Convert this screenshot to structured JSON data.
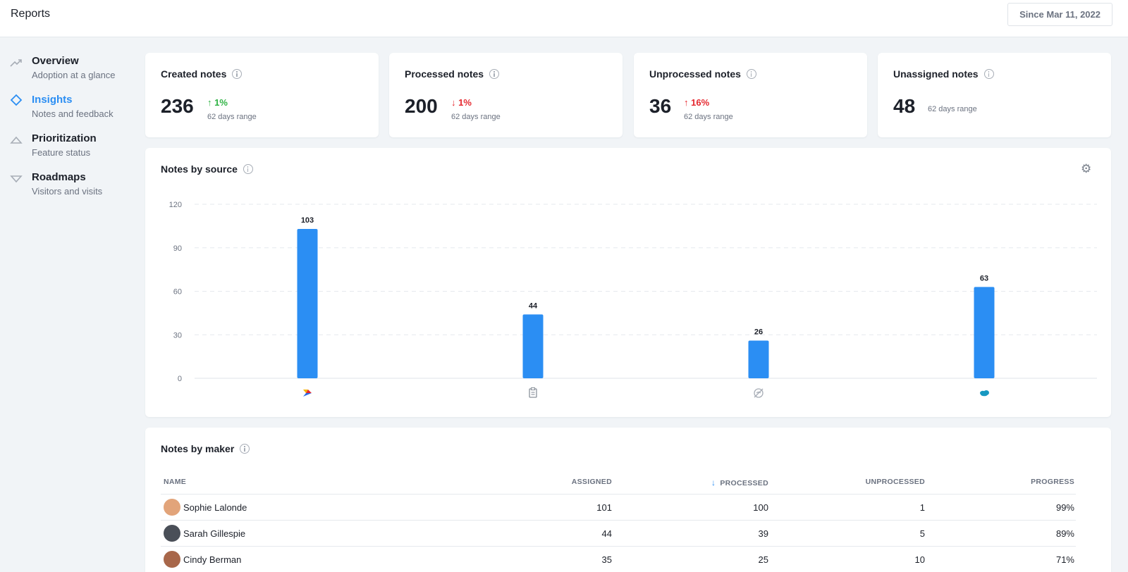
{
  "header": {
    "title": "Reports",
    "date_range": "Since Mar 11, 2022"
  },
  "sidebar": {
    "items": [
      {
        "label": "Overview",
        "sub": "Adoption at a glance",
        "icon": "trend-up-icon"
      },
      {
        "label": "Insights",
        "sub": "Notes and feedback",
        "icon": "diamond-icon",
        "active": true
      },
      {
        "label": "Prioritization",
        "sub": "Feature status",
        "icon": "triangle-up-icon"
      },
      {
        "label": "Roadmaps",
        "sub": "Visitors and visits",
        "icon": "triangle-down-icon"
      }
    ]
  },
  "stats": [
    {
      "title": "Created notes",
      "value": "236",
      "change": "1%",
      "direction": "up",
      "range": "62 days range"
    },
    {
      "title": "Processed notes",
      "value": "200",
      "change": "1%",
      "direction": "down",
      "range": "62 days range"
    },
    {
      "title": "Unprocessed notes",
      "value": "36",
      "change": "16%",
      "direction": "up-bad",
      "range": "62 days range"
    },
    {
      "title": "Unassigned notes",
      "value": "48",
      "change": "",
      "direction": "none",
      "range": "62 days range"
    }
  ],
  "notes_by_source": {
    "title": "Notes by source",
    "chart_data": {
      "type": "bar",
      "categories": [
        "productboard",
        "manual-note",
        "hidden-source",
        "salesforce"
      ],
      "values": [
        103,
        44,
        26,
        63
      ],
      "yticks": [
        0,
        30,
        60,
        90,
        120
      ],
      "ylim": [
        0,
        120
      ],
      "grid": true,
      "bar_color": "#2b8ef3"
    }
  },
  "notes_by_maker": {
    "title": "Notes by maker",
    "columns": [
      "NAME",
      "ASSIGNED",
      "PROCESSED",
      "UNPROCESSED",
      "PROGRESS"
    ],
    "sorted_column": "PROCESSED",
    "rows": [
      {
        "name": "Sophie Lalonde",
        "assigned": "101",
        "processed": "100",
        "unprocessed": "1",
        "progress": "99%",
        "avatar_color": "#e2a47a"
      },
      {
        "name": "Sarah Gillespie",
        "assigned": "44",
        "processed": "39",
        "unprocessed": "5",
        "progress": "89%",
        "avatar_color": "#4a4f58"
      },
      {
        "name": "Cindy Berman",
        "assigned": "35",
        "processed": "25",
        "unprocessed": "10",
        "progress": "71%",
        "avatar_color": "#a8674a"
      }
    ]
  }
}
